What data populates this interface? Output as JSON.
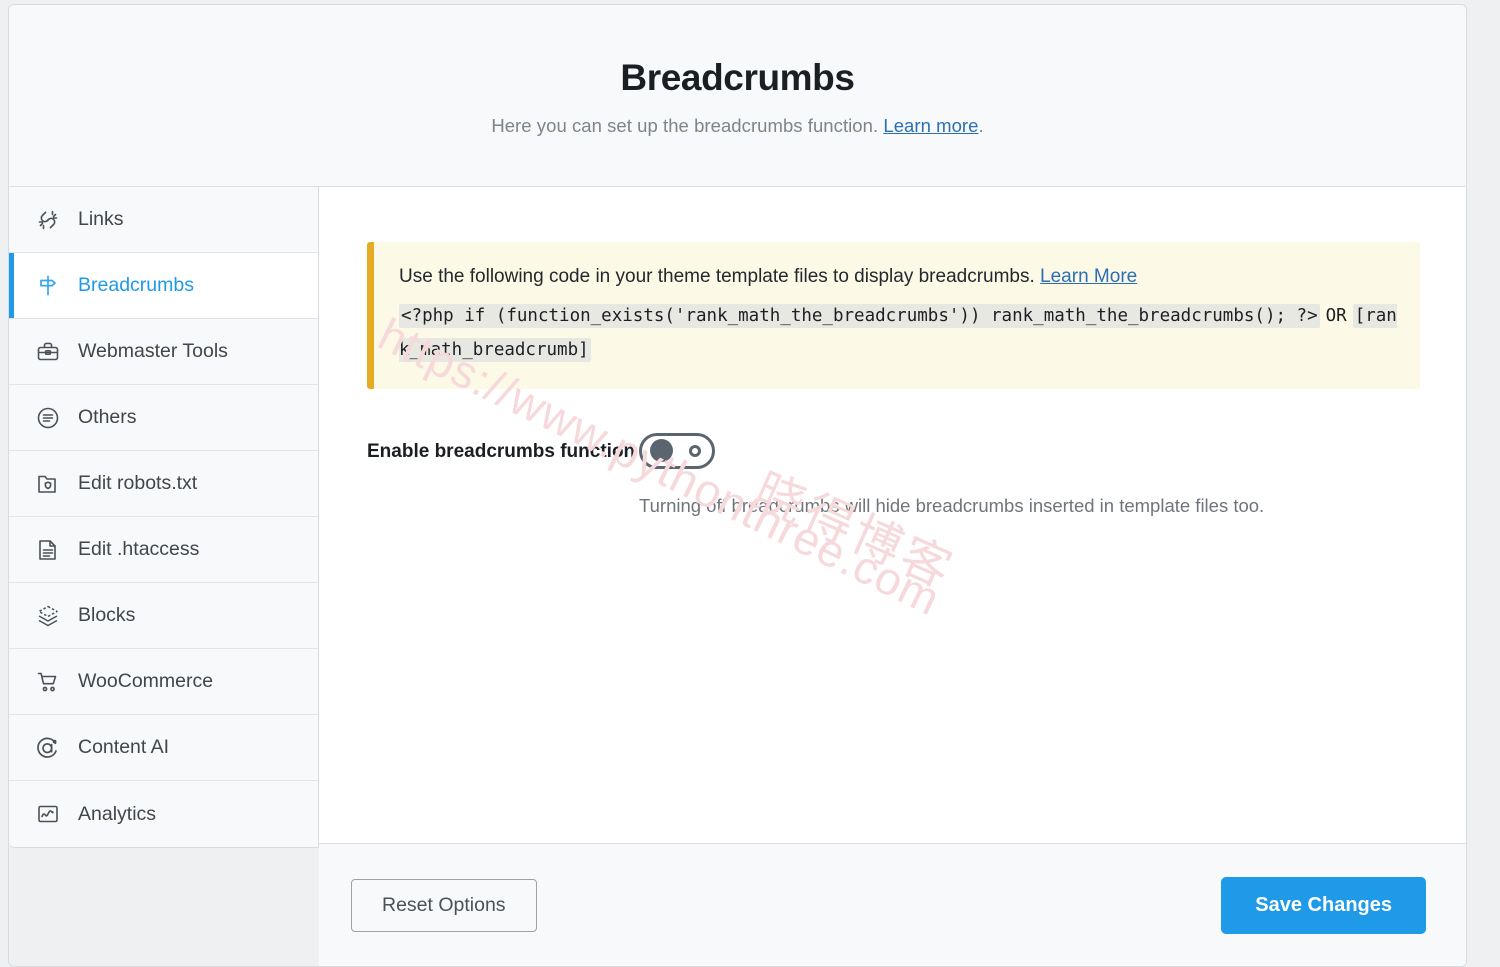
{
  "header": {
    "title": "Breadcrumbs",
    "subtitle_before": "Here you can set up the breadcrumbs function. ",
    "subtitle_link": "Learn more",
    "subtitle_after": "."
  },
  "sidebar": {
    "items": [
      {
        "label": "Links",
        "icon": "broken-link-icon",
        "active": false
      },
      {
        "label": "Breadcrumbs",
        "icon": "signpost-icon",
        "active": true
      },
      {
        "label": "Webmaster Tools",
        "icon": "toolbox-icon",
        "active": false
      },
      {
        "label": "Others",
        "icon": "list-circle-icon",
        "active": false
      },
      {
        "label": "Edit robots.txt",
        "icon": "folder-shield-icon",
        "active": false
      },
      {
        "label": "Edit .htaccess",
        "icon": "file-lines-icon",
        "active": false
      },
      {
        "label": "Blocks",
        "icon": "layers-icon",
        "active": false
      },
      {
        "label": "WooCommerce",
        "icon": "shopping-cart-icon",
        "active": false
      },
      {
        "label": "Content AI",
        "icon": "content-ai-icon",
        "active": false
      },
      {
        "label": "Analytics",
        "icon": "analytics-chart-icon",
        "active": false
      }
    ]
  },
  "notice": {
    "text_before": "Use the following code in your theme template files to display breadcrumbs. ",
    "link": "Learn More",
    "code_php": "<?php if (function_exists('rank_math_the_breadcrumbs')) rank_math_the_breadcrumbs(); ?>",
    "code_or": "OR",
    "code_shortcode": "[rank_math_breadcrumb]"
  },
  "setting": {
    "label": "Enable breadcrumbs function",
    "toggle_state": "off",
    "help": "Turning off breadcrumbs will hide breadcrumbs inserted in template files too."
  },
  "watermark": {
    "url": "https://www.pythonthree.com",
    "name": "晓得博客"
  },
  "footer": {
    "reset_label": "Reset Options",
    "save_label": "Save Changes"
  },
  "colors": {
    "accent": "#1e9ae8",
    "notice_border": "#e5ab23",
    "notice_bg": "#fdf9e7",
    "link": "#2a6fb5"
  }
}
